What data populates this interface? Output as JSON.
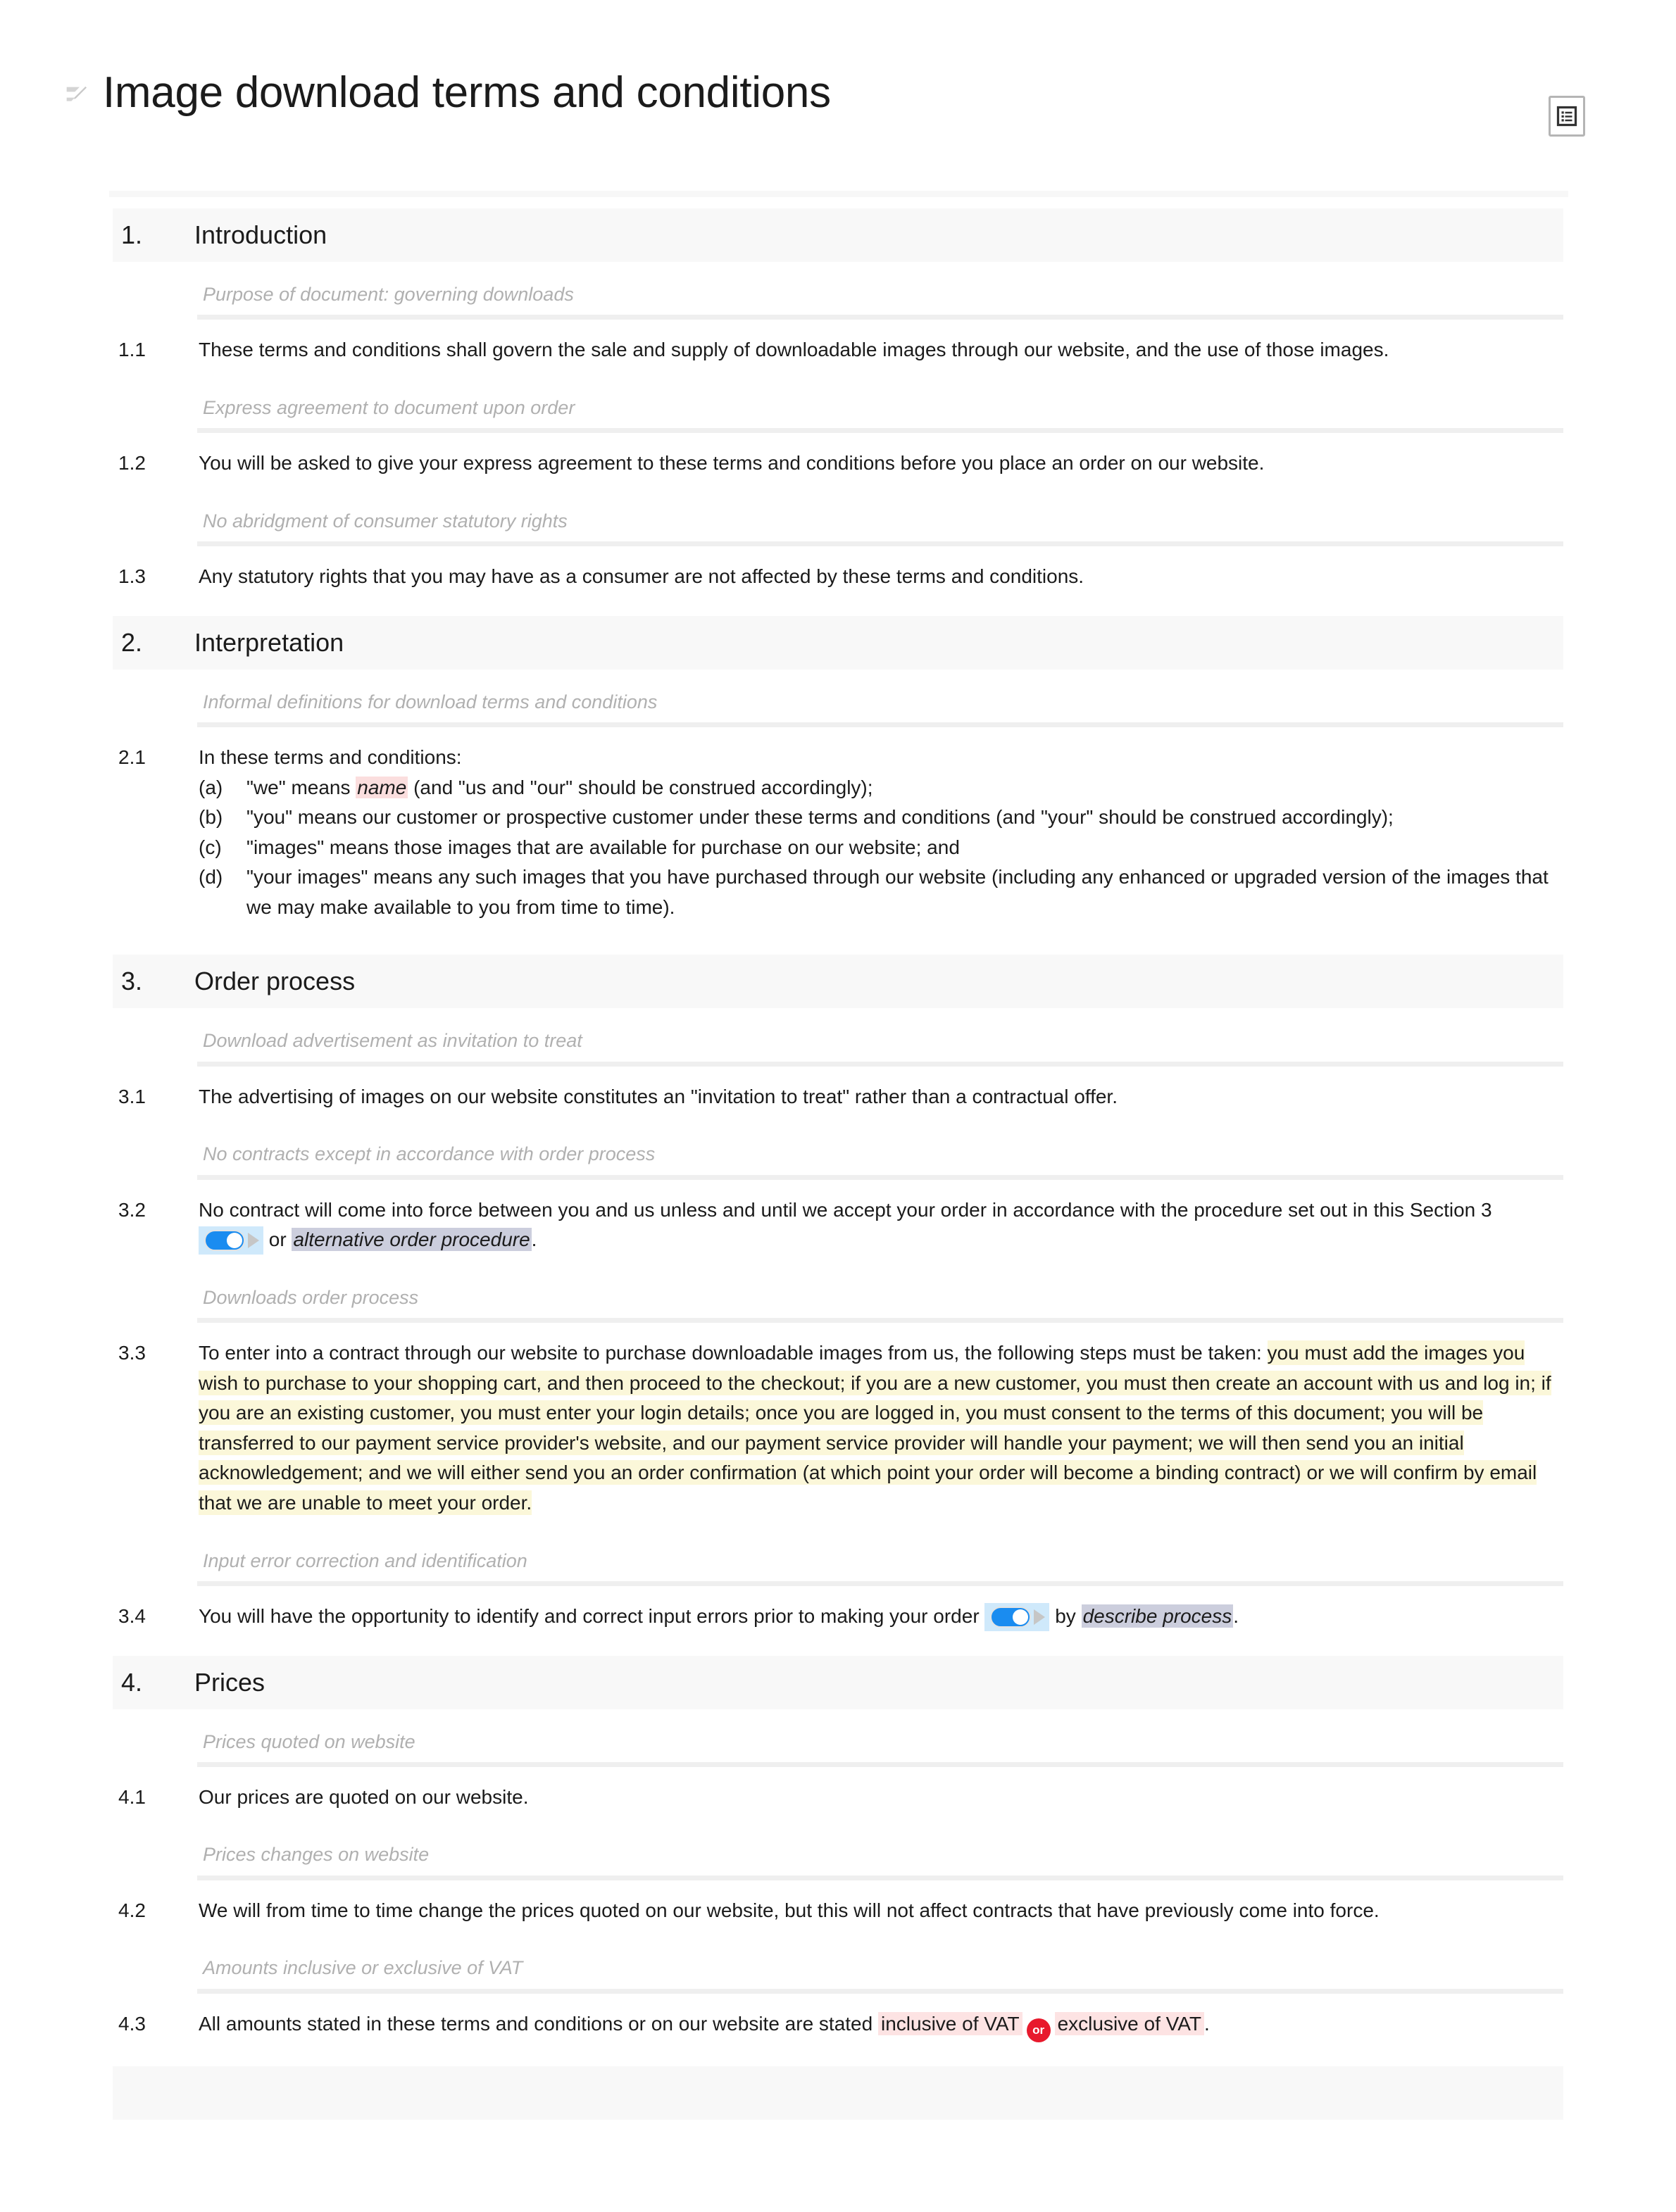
{
  "document": {
    "title": "Image download terms and conditions",
    "pencil_icon": "pencil-edit-icon",
    "toc_icon": "table-of-contents-icon"
  },
  "sections": [
    {
      "number": "1.",
      "name": "Introduction",
      "clauses": [
        {
          "guidance": "Purpose of document: governing downloads",
          "number": "1.1",
          "text": "These terms and conditions shall govern the sale and supply of downloadable images through our website, and the use of those images."
        },
        {
          "guidance": "Express agreement to document upon order",
          "number": "1.2",
          "text": "You will be asked to give your express agreement to these terms and conditions before you place an order on our website."
        },
        {
          "guidance": "No abridgment of consumer statutory rights",
          "number": "1.3",
          "text": "Any statutory rights that you may have as a consumer are not affected by these terms and conditions."
        }
      ]
    },
    {
      "number": "2.",
      "name": "Interpretation",
      "clauses": [
        {
          "guidance": "Informal definitions for download terms and conditions",
          "number": "2.1",
          "lead": "In these terms and conditions:",
          "items": [
            {
              "letter": "(a)",
              "before": "\"we\" means ",
              "variable": "name",
              "after": " (and \"us and \"our\" should be construed accordingly);"
            },
            {
              "letter": "(b)",
              "text": "\"you\" means our customer or prospective customer under these terms and conditions (and \"your\" should be construed accordingly);"
            },
            {
              "letter": "(c)",
              "text": "\"images\" means those images that are available for purchase on our website; and"
            },
            {
              "letter": "(d)",
              "text": "\"your images\" means any such images that you have purchased through our website (including any enhanced or upgraded version of the images that we may make available to you from time to time)."
            }
          ]
        }
      ]
    },
    {
      "number": "3.",
      "name": "Order process",
      "clauses": [
        {
          "guidance": "Download advertisement as invitation to treat",
          "number": "3.1",
          "text": "The advertising of images on our website constitutes an \"invitation to treat\" rather than a contractual offer."
        },
        {
          "guidance": "No contracts except in accordance with order process",
          "number": "3.2",
          "before_toggle": "No contract will come into force between you and us unless and until we accept your order in accordance with the procedure set out in this Section 3 ",
          "toggle_state": "on",
          "middle": " or ",
          "alternative": "alternative order procedure",
          "after": "."
        },
        {
          "guidance": "Downloads order process",
          "number": "3.3",
          "lead": "To enter into a contract through our website to purchase downloadable images from us, the following steps must be taken:",
          "highlighted": "you must add the images you wish to purchase to your shopping cart, and then proceed to the checkout; if you are a new customer, you must then create an account with us and log in; if you are an existing customer, you must enter your login details; once you are logged in, you must consent to the terms of this document; you will be transferred to our payment service provider's website, and our payment service provider will handle your payment; we will then send you an initial acknowledgement; and we will either send you an order confirmation (at which point your order will become a binding contract) or we will confirm by email that we are unable to meet your order."
        },
        {
          "guidance": "Input error correction and identification",
          "number": "3.4",
          "before_toggle": "You will have the opportunity to identify and correct input errors prior to making your order ",
          "toggle_state": "on",
          "middle": " by ",
          "alternative": "describe process",
          "after": "."
        }
      ]
    },
    {
      "number": "4.",
      "name": "Prices",
      "clauses": [
        {
          "guidance": "Prices quoted on website",
          "number": "4.1",
          "text": "Our prices are quoted on our website."
        },
        {
          "guidance": "Prices changes on website",
          "number": "4.2",
          "text": "We will from time to time change the prices quoted on our website, but this will not affect contracts that have previously come into force."
        },
        {
          "guidance": "Amounts inclusive or exclusive of VAT",
          "number": "4.3",
          "before": "All amounts stated in these terms and conditions or on our website are stated ",
          "option_a": "inclusive of VAT",
          "or_label": "or",
          "option_b": "exclusive of VAT",
          "after": "."
        }
      ]
    }
  ],
  "colors": {
    "section_band": "#f8f8f8",
    "guidance_text": "#b0b0b0",
    "toggle_on": "#1a8cf0",
    "toggle_track_bg": "#cfe9fb",
    "highlight_yellow": "#fbf7d9",
    "highlight_pink": "#fde3e3",
    "highlight_lavender": "#cccedd",
    "or_badge": "#e8192c"
  }
}
